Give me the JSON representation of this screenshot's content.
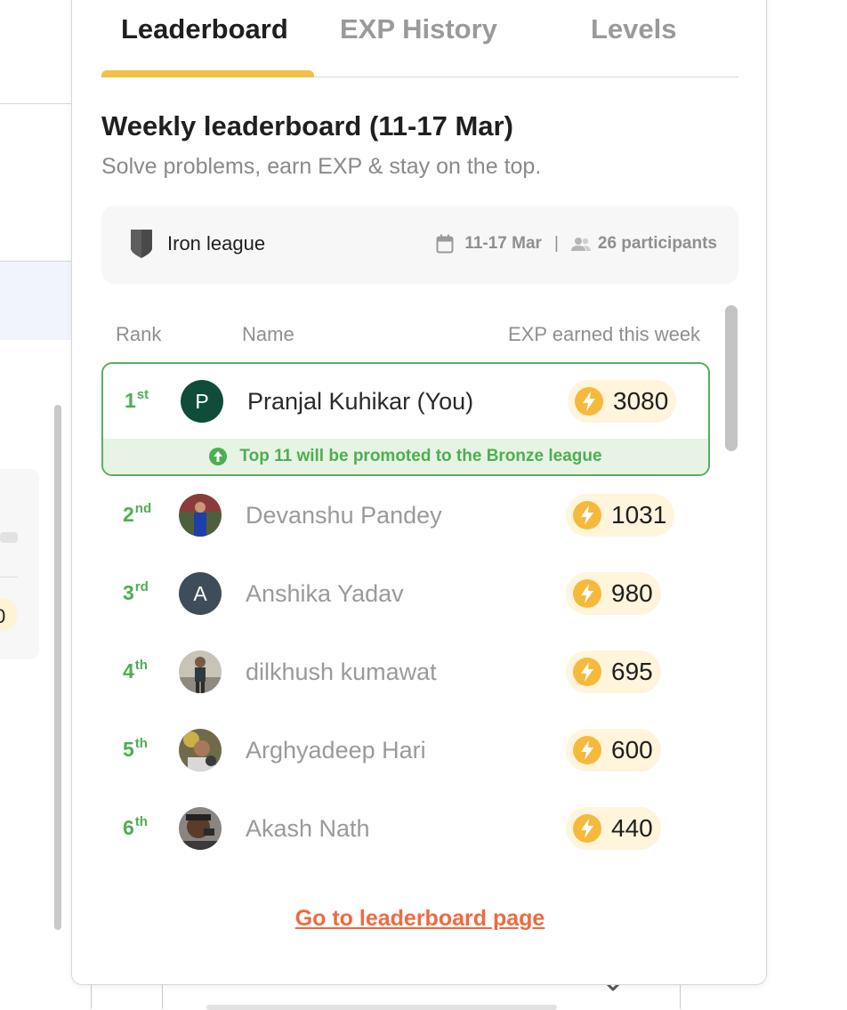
{
  "background": {
    "chip_text": "0"
  },
  "tabs": [
    {
      "label": "Leaderboard",
      "active": true
    },
    {
      "label": "EXP History",
      "active": false
    },
    {
      "label": "Levels",
      "active": false
    }
  ],
  "heading": "Weekly leaderboard (11-17 Mar)",
  "subheading": "Solve problems, earn EXP & stay on the top.",
  "league": {
    "name": "Iron league",
    "dates": "11-17 Mar",
    "separator": "|",
    "participants": "26 participants",
    "shield_icon": "shield-icon",
    "calendar_icon": "calendar-icon",
    "people_icon": "people-icon"
  },
  "columns": {
    "rank": "Rank",
    "name": "Name",
    "exp": "EXP earned this week"
  },
  "promotion_text": "Top 11 will be promoted to the Bronze league",
  "rows": [
    {
      "rank": "1",
      "suffix": "st",
      "name": "Pranjal Kuhikar (You)",
      "exp": "3080",
      "avatar_letter": "P",
      "avatar_color": "#0f4d3a",
      "is_you": true
    },
    {
      "rank": "2",
      "suffix": "nd",
      "name": "Devanshu Pandey",
      "exp": "1031",
      "avatar_letter": "",
      "avatar_color": "#3a5a9a"
    },
    {
      "rank": "3",
      "suffix": "rd",
      "name": "Anshika Yadav",
      "exp": "980",
      "avatar_letter": "A",
      "avatar_color": "#3e4d59"
    },
    {
      "rank": "4",
      "suffix": "th",
      "name": "dilkhush kumawat",
      "exp": "695",
      "avatar_letter": "",
      "avatar_color": "#6b6b6b"
    },
    {
      "rank": "5",
      "suffix": "th",
      "name": "Arghyadeep Hari",
      "exp": "600",
      "avatar_letter": "",
      "avatar_color": "#8a7a4a"
    },
    {
      "rank": "6",
      "suffix": "th",
      "name": "Akash Nath",
      "exp": "440",
      "avatar_letter": "",
      "avatar_color": "#5a4a3a"
    }
  ],
  "footer_link": "Go to leaderboard page",
  "colors": {
    "accent_tab": "#f5bf45",
    "rank_green": "#4caf50",
    "link_orange": "#ef6a3f",
    "exp_pill_bg": "#fff4dc",
    "bolt": "#f6b93b"
  }
}
